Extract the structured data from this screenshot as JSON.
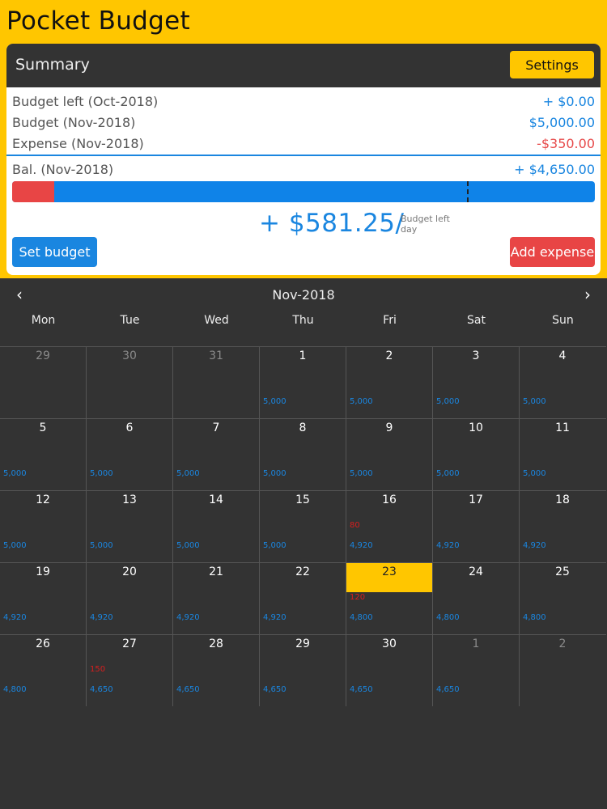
{
  "app_title": "Pocket Budget",
  "summary": {
    "title": "Summary",
    "settings_label": "Settings",
    "rows": [
      {
        "label": "Budget left (Oct-2018)",
        "value": "+ $0.00",
        "tone": "blue"
      },
      {
        "label": "Budget (Nov-2018)",
        "value": "$5,000.00",
        "tone": "blue"
      },
      {
        "label": "Expense (Nov-2018)",
        "value": "-$350.00",
        "tone": "red"
      }
    ],
    "balance_label": "Bal. (Nov-2018)",
    "balance_value": "+ $4,650.00",
    "expense_fraction": 0.072,
    "today_marker_fraction": 0.78,
    "per_day_value": "+ $581.25/",
    "per_day_caption": "Budget left day",
    "set_budget_label": "Set budget",
    "add_expense_label": "Add expense"
  },
  "calendar": {
    "prev_icon": "‹",
    "next_icon": "›",
    "month": "Nov-2018",
    "weekdays": [
      "Mon",
      "Tue",
      "Wed",
      "Thu",
      "Fri",
      "Sat",
      "Sun"
    ],
    "days": [
      {
        "d": "29",
        "other": true
      },
      {
        "d": "30",
        "other": true
      },
      {
        "d": "31",
        "other": true
      },
      {
        "d": "1",
        "b": "5,000"
      },
      {
        "d": "2",
        "b": "5,000"
      },
      {
        "d": "3",
        "b": "5,000"
      },
      {
        "d": "4",
        "b": "5,000"
      },
      {
        "d": "5",
        "b": "5,000"
      },
      {
        "d": "6",
        "b": "5,000"
      },
      {
        "d": "7",
        "b": "5,000"
      },
      {
        "d": "8",
        "b": "5,000"
      },
      {
        "d": "9",
        "b": "5,000"
      },
      {
        "d": "10",
        "b": "5,000"
      },
      {
        "d": "11",
        "b": "5,000"
      },
      {
        "d": "12",
        "b": "5,000"
      },
      {
        "d": "13",
        "b": "5,000"
      },
      {
        "d": "14",
        "b": "5,000"
      },
      {
        "d": "15",
        "b": "5,000"
      },
      {
        "d": "16",
        "e": "80",
        "b": "4,920"
      },
      {
        "d": "17",
        "b": "4,920"
      },
      {
        "d": "18",
        "b": "4,920"
      },
      {
        "d": "19",
        "b": "4,920"
      },
      {
        "d": "20",
        "b": "4,920"
      },
      {
        "d": "21",
        "b": "4,920"
      },
      {
        "d": "22",
        "b": "4,920"
      },
      {
        "d": "23",
        "e": "120",
        "b": "4,800",
        "today": true
      },
      {
        "d": "24",
        "b": "4,800"
      },
      {
        "d": "25",
        "b": "4,800"
      },
      {
        "d": "26",
        "b": "4,800"
      },
      {
        "d": "27",
        "e": "150",
        "b": "4,650"
      },
      {
        "d": "28",
        "b": "4,650"
      },
      {
        "d": "29",
        "b": "4,650"
      },
      {
        "d": "30",
        "b": "4,650"
      },
      {
        "d": "1",
        "other": true,
        "b": "4,650"
      },
      {
        "d": "2",
        "other": true
      }
    ]
  },
  "colors": {
    "accent": "#FFC600",
    "blue": "#1A86E0",
    "red": "#E84545",
    "dark": "#333333"
  }
}
